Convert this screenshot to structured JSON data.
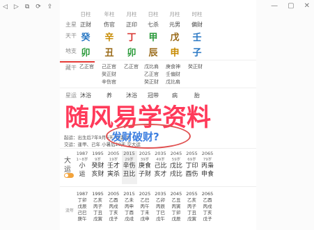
{
  "toolbar": {
    "icons": [
      "back-icon",
      "forward-icon",
      "copy-icon",
      "refresh-icon",
      "share-icon"
    ],
    "controls": [
      "minimize-icon",
      "restore-icon",
      "close-icon"
    ]
  },
  "pillars": {
    "headers": [
      "日柱",
      "年柱",
      "月柱",
      "日柱",
      "月柱",
      "时柱"
    ],
    "row_labels": {
      "zhuxing": "主星",
      "tiangan": "天干",
      "dizhi": "地支",
      "canggan": "藏干"
    },
    "zhuxing": [
      "正财",
      "伤官",
      "正印",
      "七杀",
      "元男",
      "偏财"
    ],
    "tiangan": [
      "癸",
      "辛",
      "丁",
      "甲",
      "戊",
      "壬"
    ],
    "dizhi": [
      "卯",
      "丑",
      "卯",
      "辰",
      "申",
      "子"
    ],
    "canggan": [
      [
        "乙正官"
      ],
      [
        "己正官",
        "癸正财",
        "辛伤官"
      ],
      [
        "乙正官"
      ],
      [
        "戊比肩",
        "乙正官",
        "癸正财"
      ],
      [
        "庚食神",
        "壬偏财",
        "戊比肩"
      ],
      [
        "癸正财"
      ]
    ],
    "xingyun_label": "星运",
    "xingyun": [
      "沐浴",
      "养",
      "沐浴",
      "冠带",
      "病",
      "胎"
    ]
  },
  "watermark": "随风易学资料",
  "bubble_text": "发财破财?",
  "info": {
    "line1": "起运：出生后7年9月6天7时起运",
    "line2": "交运：逢甲、己年 小暑后29天 交大运"
  },
  "dayun": {
    "label_top": "大",
    "label_bottom": "运",
    "years": [
      "1987",
      "1995",
      "2005",
      "2015",
      "2025",
      "2035",
      "2045",
      "2055",
      "2065"
    ],
    "ages": [
      "1~8岁",
      "9岁",
      "19岁",
      "29岁",
      "39岁",
      "49岁",
      "59岁",
      "69岁",
      "79岁"
    ],
    "gan": [
      "小",
      "癸财",
      "壬才",
      "辛伤",
      "庚食",
      "己比",
      "戊比",
      "丁印",
      "丙枭"
    ],
    "zhi": [
      "运",
      "亥财",
      "寅杀",
      "丑比",
      "子财",
      "亥才",
      "戌比",
      "酉伤",
      "申食"
    ]
  },
  "liunian": {
    "label": "流年",
    "years": [
      "1987",
      "1995",
      "2005",
      "2015",
      "2025",
      "2035",
      "2045",
      "2055",
      "2065"
    ],
    "rows": [
      [
        "丁卯",
        "乙亥",
        "乙酉",
        "乙未",
        "乙巳",
        "乙卯",
        "乙丑",
        "乙亥",
        "乙酉"
      ],
      [
        "戊辰",
        "丙子",
        "丙戌",
        "丙申",
        "丙午",
        "丙辰",
        "丙寅",
        "丙子",
        "丙戌"
      ],
      [
        "己巳",
        "丁丑",
        "丁亥",
        "丁酉",
        "丁未",
        "丁巳",
        "丁卯",
        "丁丑",
        "丁亥"
      ],
      [
        "庚午",
        "戊寅",
        "戊子",
        "戊戌",
        "戊申",
        "戊午",
        "戊辰",
        "戊寅",
        "戊子"
      ]
    ]
  }
}
